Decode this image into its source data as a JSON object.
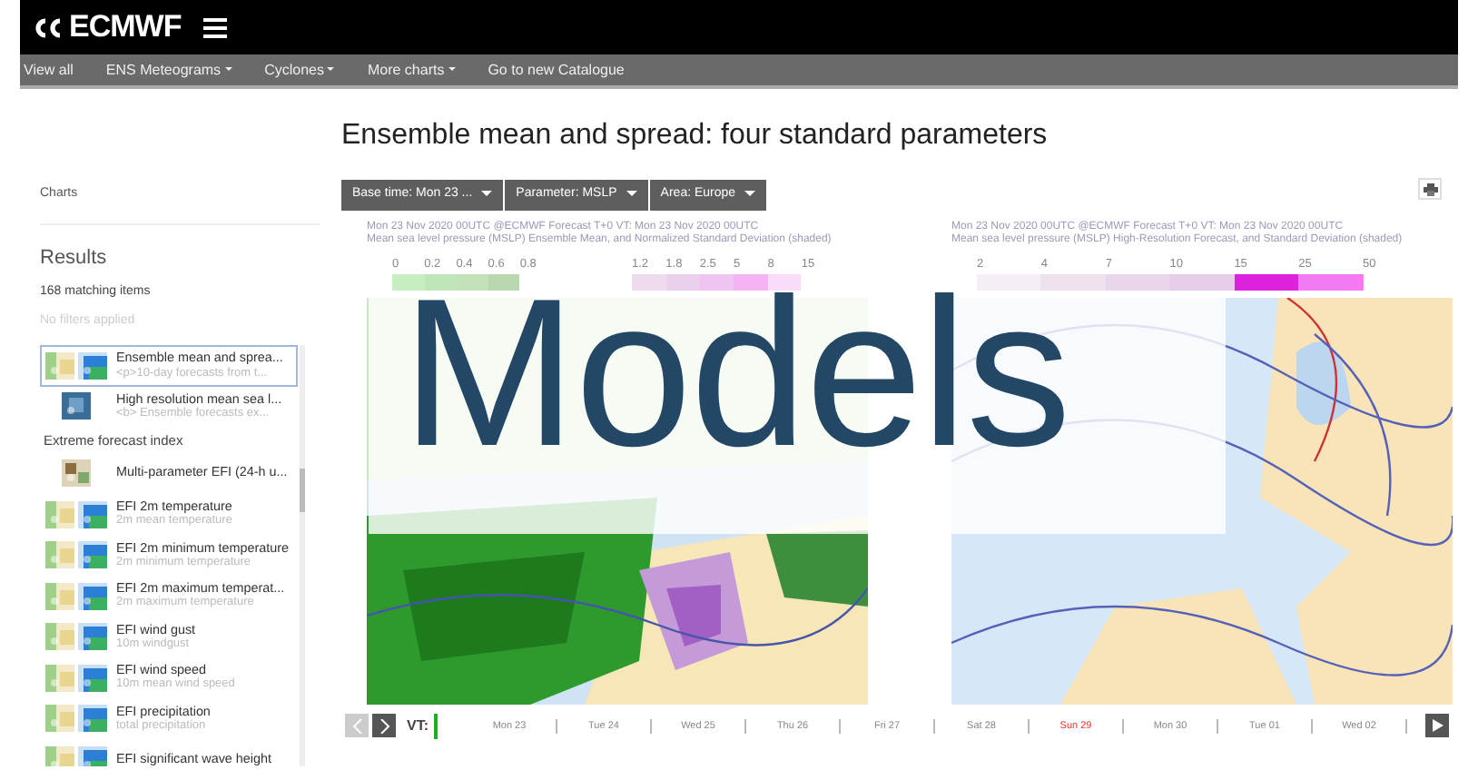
{
  "header": {
    "logo": "ECMWF"
  },
  "nav": [
    {
      "label": "View all",
      "dropdown": false
    },
    {
      "label": "ENS Meteograms",
      "dropdown": true
    },
    {
      "label": "Cyclones",
      "dropdown": true
    },
    {
      "label": "More charts",
      "dropdown": true
    },
    {
      "label": "Go to new Catalogue",
      "dropdown": false
    }
  ],
  "page_title": "Ensemble mean and spread: four standard parameters",
  "sidebar": {
    "breadcrumb": "Charts",
    "results_title": "Results",
    "count": "168 matching items",
    "filters": "No filters applied",
    "items": [
      {
        "kind": "chart-pair",
        "title": "Ensemble mean and sprea...",
        "subtitle": "<p>10-day forecasts from t...",
        "selected": true
      },
      {
        "kind": "chart-single",
        "title": "High resolution mean sea l...",
        "subtitle": "<b> Ensemble forecasts ex...",
        "selected": false
      },
      {
        "kind": "heading",
        "title": "Extreme forecast index"
      },
      {
        "kind": "chart-single",
        "title": "Multi-parameter EFI (24-h u...",
        "selected": false
      },
      {
        "kind": "chart-pair",
        "title": "EFI 2m temperature",
        "subtitle": "2m mean temperature",
        "selected": false
      },
      {
        "kind": "chart-pair",
        "title": "EFI 2m minimum temperature",
        "subtitle": "2m minimum temperature",
        "selected": false
      },
      {
        "kind": "chart-pair",
        "title": "EFI 2m maximum temperat...",
        "subtitle": "2m maximum temperature",
        "selected": false
      },
      {
        "kind": "chart-pair",
        "title": "EFI wind gust",
        "subtitle": "10m windgust",
        "selected": false
      },
      {
        "kind": "chart-pair",
        "title": "EFI wind speed",
        "subtitle": "10m mean wind speed",
        "selected": false
      },
      {
        "kind": "chart-pair",
        "title": "EFI precipitation",
        "subtitle": "total precipitation",
        "selected": false
      },
      {
        "kind": "chart-pair",
        "title": "EFI significant wave height",
        "selected": false
      }
    ]
  },
  "toolbar": {
    "dropdowns": [
      "Base time: Mon 23 ...",
      "Parameter: MSLP",
      "Area: Europe"
    ]
  },
  "panels": [
    {
      "line1": "Mon 23 Nov 2020 00UTC @ECMWF Forecast T+0 VT: Mon 23 Nov 2020 00UTC",
      "line2": "Mean sea level pressure (MSLP) Ensemble Mean, and Normalized Standard Deviation (shaded)",
      "legends": [
        {
          "ticks": [
            "0",
            "0.2",
            "0.4",
            "0.6",
            "0.8"
          ],
          "segments": [
            {
              "color": "#c6efc0"
            },
            {
              "color": "#bfe6b8"
            },
            {
              "color": "#c2e2ba"
            },
            {
              "color": "#b8d8b0"
            }
          ]
        },
        {
          "ticks": [
            "1.2",
            "1.8",
            "2.5",
            "5",
            "8",
            "15"
          ],
          "segments": [
            {
              "color": "#eedcee"
            },
            {
              "color": "#ead0ea"
            },
            {
              "color": "#f0c4f0"
            },
            {
              "color": "#f4b4f4"
            },
            {
              "color": "#f8dcf8"
            }
          ]
        }
      ]
    },
    {
      "line1": "Mon 23 Nov 2020 00UTC @ECMWF Forecast T+0 VT: Mon 23 Nov 2020 00UTC",
      "line2": "Mean sea level pressure (MSLP) High-Resolution Forecast, and Standard Deviation (shaded)",
      "legends": [
        {
          "ticks": [
            "2",
            "4",
            "7",
            "10",
            "15",
            "25",
            "50"
          ],
          "segments": [
            {
              "color": "#f6eef6"
            },
            {
              "color": "#eee2ee"
            },
            {
              "color": "#ead6ea"
            },
            {
              "color": "#e6cce6"
            },
            {
              "color": "#dd22dd"
            },
            {
              "color": "#f27af2"
            }
          ]
        }
      ]
    }
  ],
  "timeline": {
    "label": "VT:",
    "days": [
      {
        "label": "Mon 23",
        "highlighted": false
      },
      {
        "label": "Tue 24",
        "highlighted": false
      },
      {
        "label": "Wed 25",
        "highlighted": false
      },
      {
        "label": "Thu 26",
        "highlighted": false
      },
      {
        "label": "Fri 27",
        "highlighted": false
      },
      {
        "label": "Sat 28",
        "highlighted": false
      },
      {
        "label": "Sun 29",
        "highlighted": true
      },
      {
        "label": "Mon 30",
        "highlighted": false
      },
      {
        "label": "Tue 01",
        "highlighted": false
      },
      {
        "label": "Wed 02",
        "highlighted": false
      }
    ]
  },
  "overlay": {
    "title": "Models"
  }
}
